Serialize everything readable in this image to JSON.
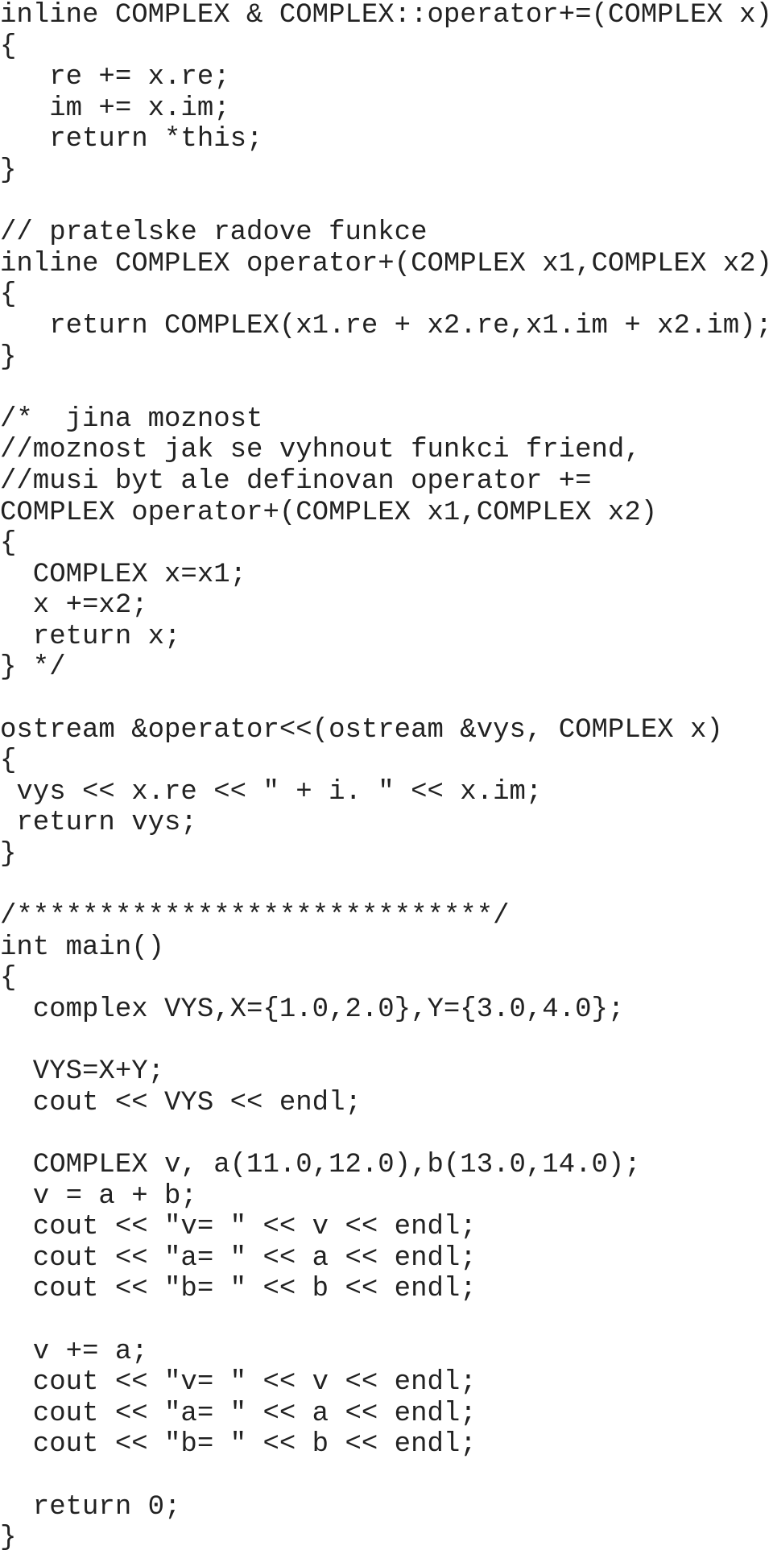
{
  "document": {
    "language": "C++",
    "lines": [
      "inline COMPLEX & COMPLEX::operator+=(COMPLEX x)",
      "{",
      "   re += x.re;",
      "   im += x.im;",
      "   return *this;",
      "}",
      "",
      "// pratelske radove funkce",
      "inline COMPLEX operator+(COMPLEX x1,COMPLEX x2)",
      "{",
      "   return COMPLEX(x1.re + x2.re,x1.im + x2.im);",
      "}",
      "",
      "/*  jina moznost",
      "//moznost jak se vyhnout funkci friend,",
      "//musi byt ale definovan operator +=",
      "COMPLEX operator+(COMPLEX x1,COMPLEX x2)",
      "{",
      "  COMPLEX x=x1;",
      "  x +=x2;",
      "  return x;",
      "} */",
      "",
      "ostream &operator<<(ostream &vys, COMPLEX x)",
      "{",
      " vys << x.re << \" + i. \" << x.im;",
      " return vys;",
      "}",
      "",
      "/*****************************/",
      "int main()",
      "{",
      "  complex VYS,X={1.0,2.0},Y={3.0,4.0};",
      "",
      "  VYS=X+Y;",
      "  cout << VYS << endl;",
      "",
      "  COMPLEX v, a(11.0,12.0),b(13.0,14.0);",
      "  v = a + b;",
      "  cout << \"v= \" << v << endl;",
      "  cout << \"a= \" << a << endl;",
      "  cout << \"b= \" << b << endl;",
      "",
      "  v += a;",
      "  cout << \"v= \" << v << endl;",
      "  cout << \"a= \" << a << endl;",
      "  cout << \"b= \" << b << endl;",
      "",
      "  return 0;",
      "}"
    ]
  }
}
